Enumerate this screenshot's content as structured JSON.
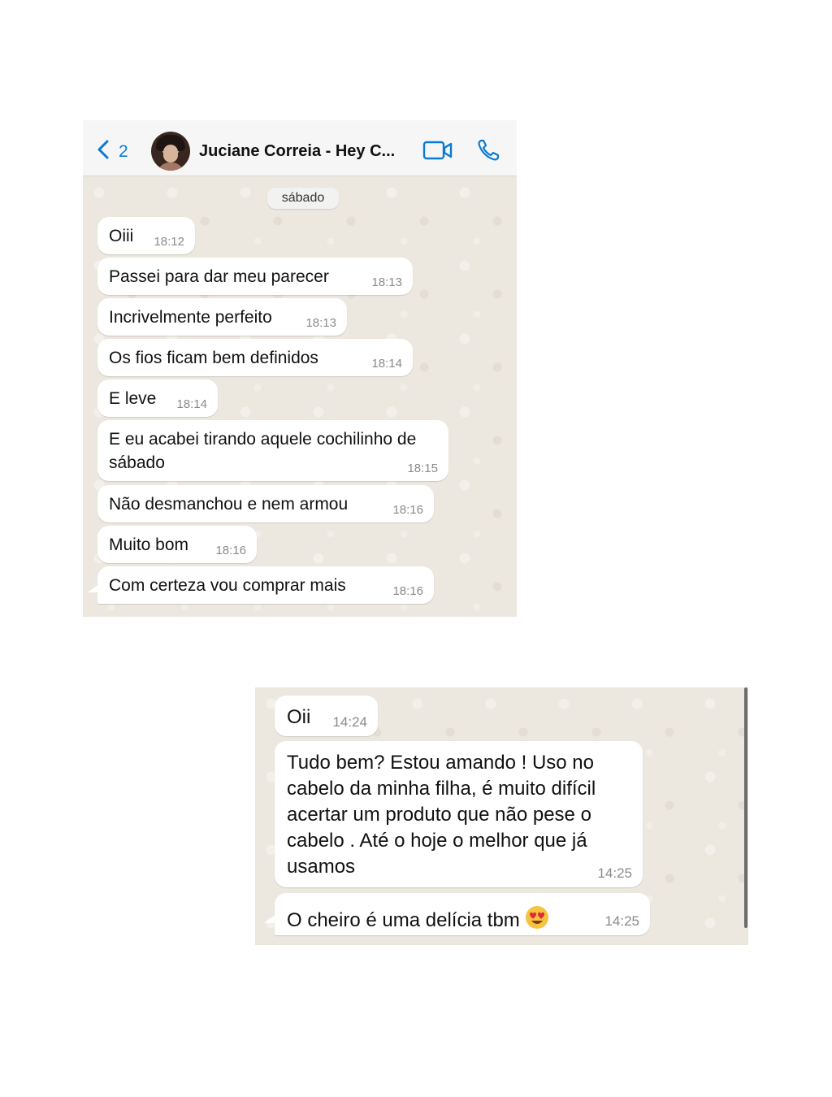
{
  "chat1": {
    "header": {
      "unread_count": "2",
      "contact_name": "Juciane Correia - Hey C..."
    },
    "date_label": "sábado",
    "messages": [
      {
        "text": "Oiii",
        "time": "18:12"
      },
      {
        "text": "Passei para dar meu parecer",
        "time": "18:13"
      },
      {
        "text": "Incrivelmente perfeito",
        "time": "18:13"
      },
      {
        "text": "Os fios ficam bem definidos",
        "time": "18:14"
      },
      {
        "text": "E leve",
        "time": "18:14"
      },
      {
        "text": "E eu acabei tirando aquele cochilinho de sábado",
        "time": "18:15"
      },
      {
        "text": "Não desmanchou e nem armou",
        "time": "18:16"
      },
      {
        "text": "Muito bom",
        "time": "18:16"
      },
      {
        "text": "Com certeza vou comprar mais",
        "time": "18:16"
      }
    ]
  },
  "chat2": {
    "messages": [
      {
        "text": "Oii",
        "time": "14:24"
      },
      {
        "text": "Tudo bem? Estou amando ! Uso no cabelo da minha filha, é muito difícil acertar um produto que não pese o cabelo . Até o hoje o melhor que já usamos",
        "time": "14:25"
      },
      {
        "text": "O cheiro é uma delícia tbm",
        "time": "14:25",
        "emoji": "heart-eyes-emoji"
      }
    ]
  },
  "colors": {
    "accent": "#0a7bd3",
    "chat_background": "#ece7df",
    "bubble": "#ffffff",
    "timestamp": "#8a8a8a"
  }
}
